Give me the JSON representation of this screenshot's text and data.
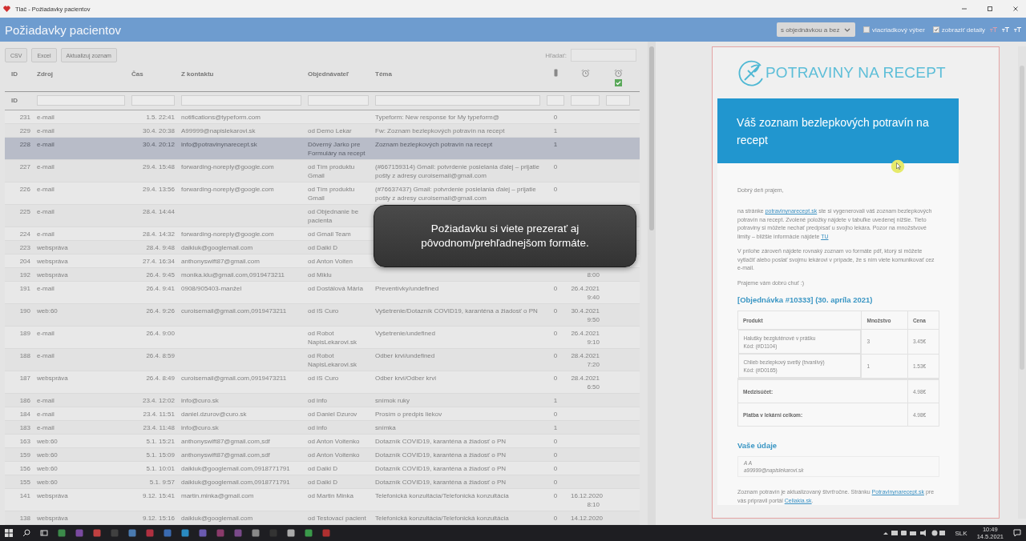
{
  "window": {
    "title": "Tlač - Požiadavky pacientov"
  },
  "header": {
    "title": "Požiadavky pacientov",
    "filter": {
      "value": "s objednávkou a bez"
    },
    "options": [
      {
        "label": "viacriadkový výber",
        "checked": false
      },
      {
        "label": "zobraziť detaily",
        "checked": true
      }
    ]
  },
  "toolbar": {
    "buttons": [
      "CSV",
      "Excel",
      "Aktualizuj zoznam"
    ],
    "search": {
      "label": "Hľadať:"
    }
  },
  "table": {
    "columns": [
      {
        "label": "ID",
        "kind": "text"
      },
      {
        "label": "Zdroj",
        "kind": "text"
      },
      {
        "label": "Čas",
        "kind": "text"
      },
      {
        "label": "Z kontaktu",
        "kind": "text"
      },
      {
        "label": "Objednávateľ",
        "kind": "text"
      },
      {
        "label": "Téma",
        "kind": "text"
      },
      {
        "kind": "phone"
      },
      {
        "kind": "alarm"
      },
      {
        "kind": "alarm-done"
      }
    ],
    "filter_row": {
      "label": "ID"
    },
    "rows": [
      {
        "id": "231",
        "source": "e-mail",
        "time": "1.5. 22:41",
        "contact": "notifications@typeform.com",
        "topic": "Typeform: New response for My typeform@",
        "count": "0",
        "selected": false
      },
      {
        "id": "229",
        "source": "e-mail",
        "time": "30.4. 20:38",
        "contact": "A99999@napislekarovi.sk",
        "orderer": "od Demo Lekar",
        "topic": "Fw: Zoznam bezlepkových potravín na recept",
        "count": "1",
        "selected": false
      },
      {
        "id": "228",
        "source": "e-mail",
        "time": "30.4. 20:12",
        "contact": "info@potravinynarecept.sk",
        "orderer": "Dôverný Jarko pre Formuláry na recept",
        "topic": "Zoznam bezlepkových potravín na recept",
        "count": "1",
        "selected": true
      },
      {
        "id": "227",
        "source": "e-mail",
        "time": "29.4. 15:48",
        "contact": "forwarding-noreply@google.com",
        "orderer": "od Tím produktu Gmail",
        "topic": "(#667159314) Gmail: potvrdenie posielania ďalej – prijatie pošty z adresy curoisemail@gmail.com",
        "count": "0",
        "selected": false
      },
      {
        "id": "226",
        "source": "e-mail",
        "time": "29.4. 13:56",
        "contact": "forwarding-noreply@google.com",
        "orderer": "od Tím produktu Gmail",
        "topic": "(#76637437) Gmail: potvrdenie posielania ďalej – prijatie pošty z adresy curoisemail@gmail.com",
        "count": "0",
        "selected": false
      },
      {
        "id": "225",
        "source": "e-mail",
        "time": "28.4. 14:44",
        "orderer": "od Objednanie be pacienta",
        "selected": false
      },
      {
        "id": "224",
        "source": "e-mail",
        "time": "28.4. 14:32",
        "contact": "forwarding-noreply@google.com",
        "orderer": "od Gmail Team",
        "selected": false
      },
      {
        "id": "223",
        "source": "webspráva",
        "time": "28.4. 9:48",
        "contact": "daikiuk@googlemail.com",
        "orderer": "od Daiki D",
        "selected": false
      },
      {
        "id": "204",
        "source": "webspráva",
        "time": "27.4. 16:34",
        "contact": "anthonyswift87@gmail.com",
        "orderer": "od Anton Voiten",
        "selected": false
      },
      {
        "id": "192",
        "source": "webspráva",
        "time": "26.4. 9:45",
        "contact": "monika.klu@gmail.com,0919473211",
        "orderer": "od Miklu",
        "date": "8:00",
        "selected": false
      },
      {
        "id": "191",
        "source": "e-mail",
        "time": "26.4. 9:41",
        "contact": "0908/905403-manžel",
        "orderer": "od Dostálová Mária",
        "topic": "Preventívky/undefined",
        "count": "0",
        "date": "26.4.2021 9:40",
        "selected": false
      },
      {
        "id": "190",
        "source": "web:60",
        "time": "26.4. 9:26",
        "contact": "curoisemail@gmail.com,0919473211",
        "orderer": "od IS Curo",
        "topic": "Vyšetrenie/Dotazník COVID19, karanténa a žiadosť o PN",
        "count": "0",
        "date": "30.4.2021 9:50",
        "selected": false
      },
      {
        "id": "189",
        "source": "e-mail",
        "time": "26.4. 9:00",
        "orderer": "od Robot NapisLekarovi.sk",
        "topic": "Vyšetrenie/undefined",
        "count": "0",
        "date": "26.4.2021 9:10",
        "selected": false
      },
      {
        "id": "188",
        "source": "e-mail",
        "time": "26.4. 8:59",
        "orderer": "od Robot NapisLekarovi.sk",
        "topic": "Odber krvi/undefined",
        "count": "0",
        "date": "28.4.2021 7:20",
        "selected": false
      },
      {
        "id": "187",
        "source": "webspráva",
        "time": "26.4. 8:49",
        "contact": "curoisemail@gmail.com,0919473211",
        "orderer": "od IS Curo",
        "topic": "Odber krvi/Odber krvi",
        "count": "0",
        "date": "28.4.2021 6:50",
        "selected": false
      },
      {
        "id": "186",
        "source": "e-mail",
        "time": "23.4. 12:02",
        "contact": "info@curo.sk",
        "orderer": "od info",
        "topic": "snímok ruky",
        "count": "1",
        "selected": false
      },
      {
        "id": "184",
        "source": "e-mail",
        "time": "23.4. 11:51",
        "contact": "daniel.dzurov@curo.sk",
        "orderer": "od Daniel Dzurov",
        "topic": "Prosím o predpis liekov",
        "count": "0",
        "selected": false
      },
      {
        "id": "183",
        "source": "e-mail",
        "time": "23.4. 11:48",
        "contact": "info@curo.sk",
        "orderer": "od info",
        "topic": "snímka",
        "count": "1",
        "selected": false
      },
      {
        "id": "163",
        "source": "web:60",
        "time": "5.1. 15:21",
        "contact": "anthonyswift87@gmail.com,sdf",
        "orderer": "od Anton Voitenko",
        "topic": "Dotazník COVID19, karanténa a žiadosť o PN",
        "count": "0",
        "selected": false
      },
      {
        "id": "159",
        "source": "web:60",
        "time": "5.1. 15:09",
        "contact": "anthonyswift87@gmail.com,sdf",
        "orderer": "od Anton Voitenko",
        "topic": "Dotazník COVID19, karanténa a žiadosť o PN",
        "count": "0",
        "selected": false
      },
      {
        "id": "156",
        "source": "web:60",
        "time": "5.1. 10:01",
        "contact": "daikiuk@googlemail.com,0918771791",
        "orderer": "od Daiki D",
        "topic": "Dotazník COVID19, karanténa a žiadosť o PN",
        "count": "0",
        "selected": false
      },
      {
        "id": "155",
        "source": "web:60",
        "time": "5.1. 9:57",
        "contact": "daikiuk@googlemail.com,0918771791",
        "orderer": "od Daiki D",
        "topic": "Dotazník COVID19, karanténa a žiadosť o PN",
        "count": "0",
        "selected": false
      },
      {
        "id": "141",
        "source": "webspráva",
        "time": "9.12. 15:41",
        "contact": "martin.minka@gmail.com",
        "orderer": "od Martin Minka",
        "topic": "Telefonická konzultácia/Telefonická konzultácia",
        "count": "0",
        "date": "16.12.2020 8:10",
        "selected": false
      },
      {
        "id": "138",
        "source": "webspráva",
        "time": "9.12. 15:16",
        "contact": "daikiuk@googlemail.com",
        "orderer": "od Testovací pacient",
        "topic": "Telefonická konzultácia/Telefonická konzultácia",
        "count": "0",
        "date": "14.12.2020",
        "selected": false
      }
    ]
  },
  "overlay": {
    "message": "Požiadavku si viete prezerať aj pôvodnom/prehľadnejšom formáte."
  },
  "email": {
    "logo": "POTRAVINY NA RECEPT",
    "heading": "Váš zoznam bezlepkových potravín na recept",
    "greeting": "Dobrý deň prajem,",
    "paragraphs": [
      {
        "parts": [
          {
            "text": "na stránke "
          },
          {
            "text": "potravinynarecept.sk",
            "link": true
          },
          {
            "text": " ste si vygenerovali váš zoznam bezlepkových potravín na recept. Zvolené položky nájdete v tabuľke uvedenej nižšie. Tieto potraviny si môžete nechať predpísať u svojho lekára. Pozor na množstvové limity – bližšie informácie nájdete "
          },
          {
            "text": "TU",
            "link": true
          }
        ]
      },
      {
        "parts": [
          {
            "text": "V prílohe zároveň nájdete rovnaký zoznam vo formáte pdf, ktorý si môžete vytlačiť alebo poslať svojmu lekárovi v prípade, že s ním viete komunikovať cez e-mail."
          }
        ]
      },
      {
        "parts": [
          {
            "text": "Prajeme vám dobrú chuť :)"
          }
        ]
      }
    ],
    "order_title": "[Objednávka #10333] (30. apríla 2021)",
    "order_table": {
      "columns": [
        "Produkt",
        "Množstvo",
        "Cena"
      ],
      "items": [
        {
          "name": "Halušky bezgluténové v prášku",
          "code": "Kód: (#D1104)",
          "quantity": "3",
          "price": "3.45€"
        },
        {
          "name": "Chlieb bezlepkový svetlý (trvanlivý)",
          "code": "Kód: (#D0165)",
          "quantity": "1",
          "price": "1.53€"
        }
      ],
      "totals": [
        {
          "label": "Medzisúčet:",
          "value": "4.98€"
        },
        {
          "label": "Platba v lekárni celkom:",
          "value": "4.98€"
        }
      ]
    },
    "details_title": "Vaše údaje",
    "details": [
      "A A",
      "a99999@napislekarovi.sk"
    ],
    "footer": {
      "parts": [
        {
          "text": "Zoznam potravín je aktualizovaný štvrťročne. Stránku "
        },
        {
          "text": "Potravinynarecept.sk",
          "link": true
        },
        {
          "text": " pre vás pripravil portál "
        },
        {
          "text": "Celiakia.sk",
          "link": true
        },
        {
          "text": "."
        }
      ]
    }
  },
  "taskbar": {
    "language": "SLK",
    "time": "10:49",
    "date": "14.5.2021"
  }
}
